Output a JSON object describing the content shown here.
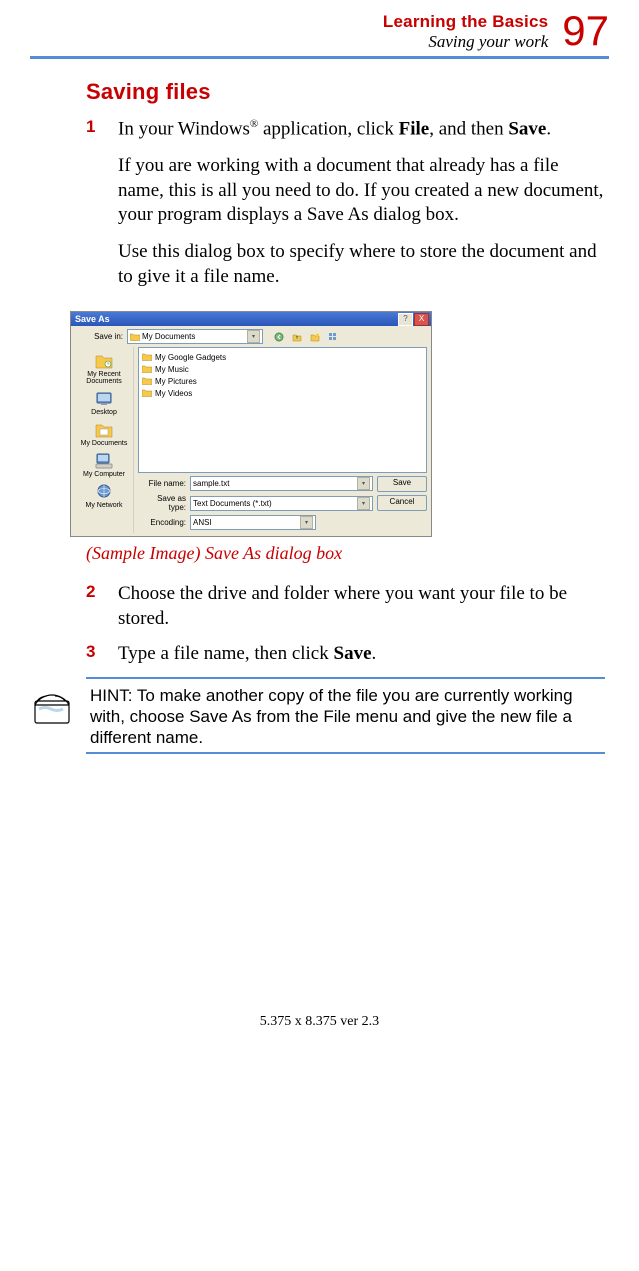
{
  "header": {
    "chapter": "Learning the Basics",
    "section": "Saving your work",
    "page_number": "97"
  },
  "heading": "Saving files",
  "steps": {
    "s1": {
      "num": "1",
      "text_a": "In your Windows",
      "reg": "®",
      "text_b": " application, click ",
      "bold1": "File",
      "text_c": ", and then ",
      "bold2": "Save",
      "text_d": ".",
      "para1": "If you are working with a document that already has a file name, this is all you need to do. If you created a new document, your program displays a Save As dialog box.",
      "para2": "Use this dialog box to specify where to store the document and to give it a file name."
    },
    "s2": {
      "num": "2",
      "text": "Choose the drive and folder where you want your file to be stored."
    },
    "s3": {
      "num": "3",
      "text_a": "Type a file name, then click ",
      "bold": "Save",
      "text_b": "."
    }
  },
  "caption": "(Sample Image) Save As dialog box",
  "dialog": {
    "title": "Save As",
    "help": "?",
    "close": "X",
    "savein_label": "Save in:",
    "savein_value": "My Documents",
    "places": {
      "recent": "My Recent Documents",
      "desktop": "Desktop",
      "mydocs": "My Documents",
      "mycomp": "My Computer",
      "mynet": "My Network"
    },
    "files": {
      "f1": "My Google Gadgets",
      "f2": "My Music",
      "f3": "My Pictures",
      "f4": "My Videos"
    },
    "filename_label": "File name:",
    "filename_value": "sample.txt",
    "saveas_label": "Save as type:",
    "saveas_value": "Text Documents (*.txt)",
    "encoding_label": "Encoding:",
    "encoding_value": "ANSI",
    "btn_save": "Save",
    "btn_cancel": "Cancel"
  },
  "hint": "HINT: To make another copy of the file you are currently working with, choose Save As from the File menu and give the new file a different name.",
  "footer": "5.375 x 8.375 ver 2.3"
}
